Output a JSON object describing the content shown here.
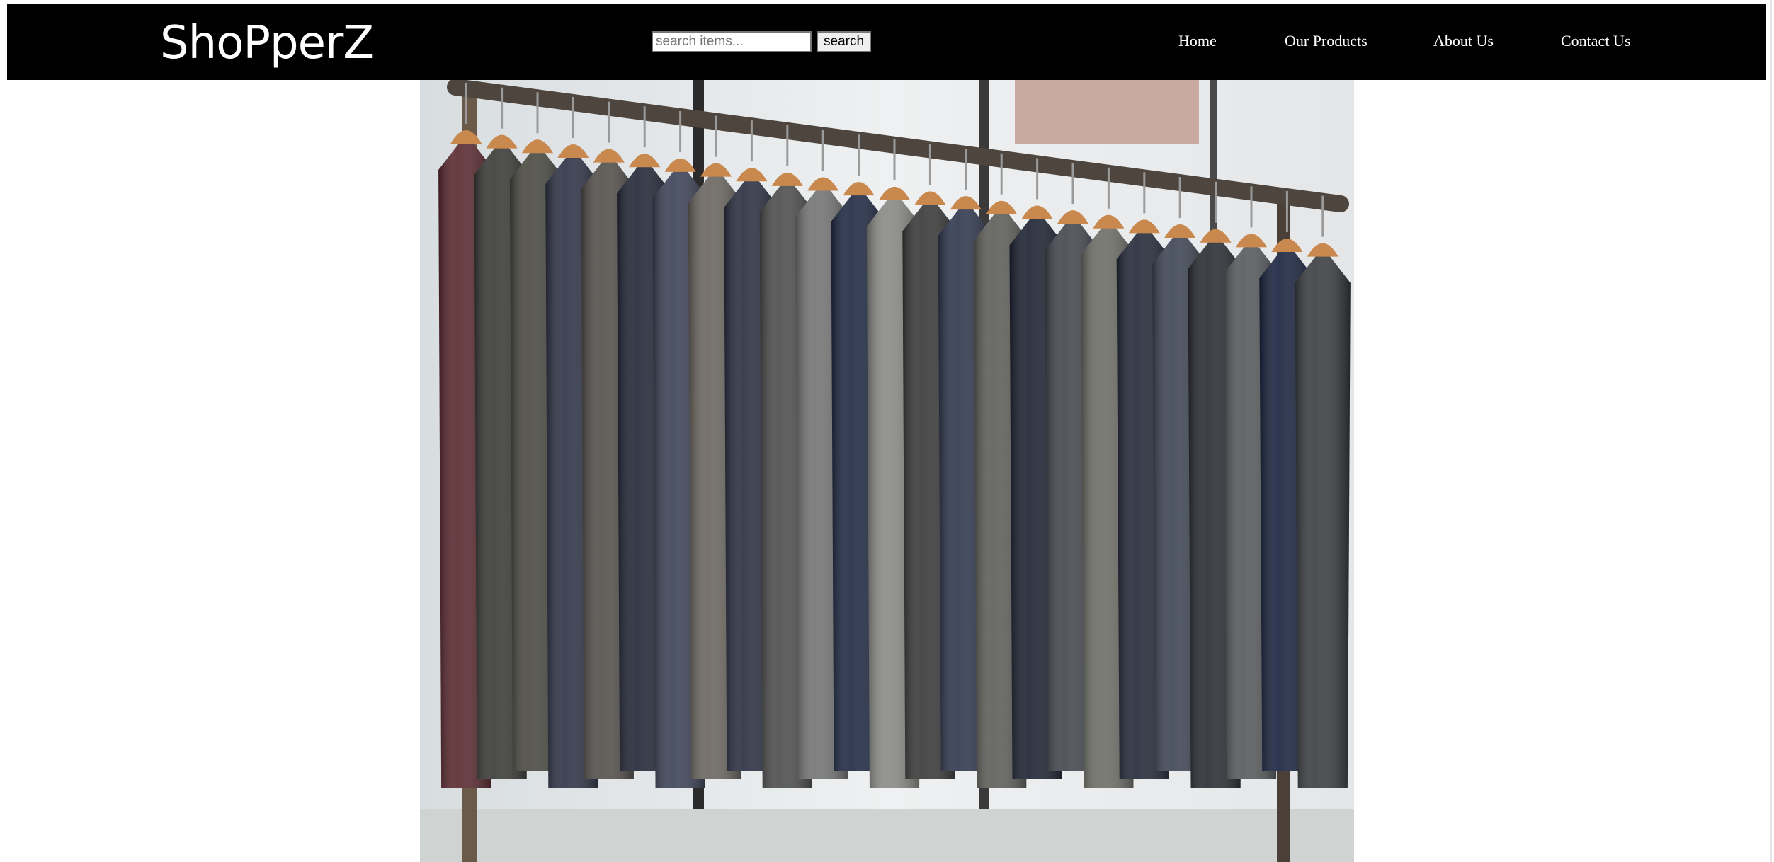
{
  "header": {
    "logo_text": "ShoPperZ",
    "search": {
      "placeholder": "search items...",
      "value": "",
      "button_label": "search"
    },
    "nav": [
      {
        "label": "Home"
      },
      {
        "label": "Our Products"
      },
      {
        "label": "About Us"
      },
      {
        "label": "Contact Us"
      }
    ]
  },
  "colors": {
    "navbar_bg": "#000000",
    "nav_text": "#ffffff",
    "page_bg": "#ffffff"
  },
  "hero": {
    "image_subject": "clothing-rack-with-suit-jackets",
    "jacket_colors": [
      "#5a2a30",
      "#3b3b38",
      "#4a4a42",
      "#2e3447",
      "#54504c",
      "#232838",
      "#3d4358",
      "#6b6660",
      "#2b3042",
      "#4e4e4e",
      "#757575",
      "#1f2a44",
      "#8a8a86",
      "#3a3a3a",
      "#30384f",
      "#5f5f5a",
      "#1d2333",
      "#44484f",
      "#6e6e68",
      "#252a3a",
      "#3f4655",
      "#2a2d33",
      "#585a5c",
      "#1a2440",
      "#3c3e42"
    ]
  }
}
